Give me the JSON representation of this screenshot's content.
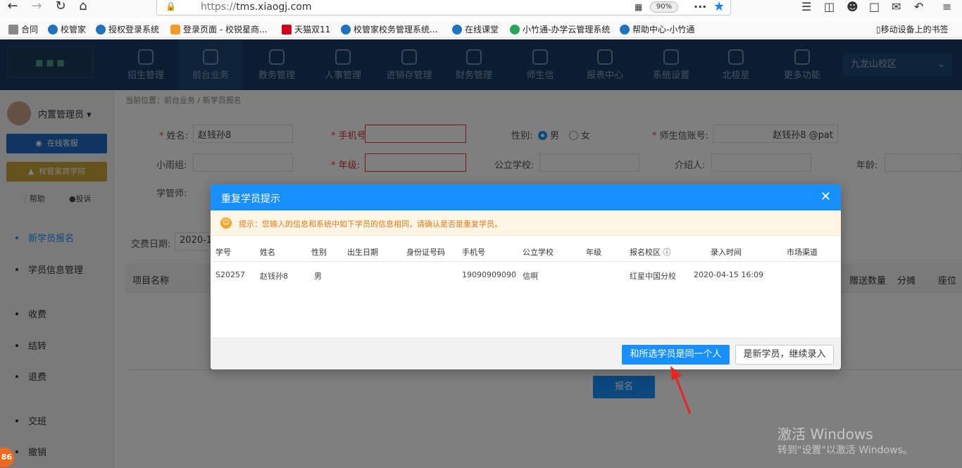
{
  "browser": {
    "url_prefix": "https://",
    "url_host": "tms.xiaogj.com",
    "zoom": "90%",
    "bookmarks": [
      {
        "label": "合同",
        "color": "#888888"
      },
      {
        "label": "校管家",
        "color": "#1e73be"
      },
      {
        "label": "授权登录系统",
        "color": "#1e73be"
      },
      {
        "label": "登录页面 - 校锐星商...",
        "color": "#f59a23"
      },
      {
        "label": "天猫双11",
        "color": "#d0021b"
      },
      {
        "label": "校管家校务管理系统...",
        "color": "#1e73be"
      },
      {
        "label": "在线课堂",
        "color": "#1e73be"
      },
      {
        "label": "小竹通-办学云管理系统",
        "color": "#26a65b"
      },
      {
        "label": "帮助中心-小竹通",
        "color": "#1e73be"
      }
    ],
    "mobile_bookmarks": "移动设备上的书签"
  },
  "app": {
    "nav": [
      {
        "label": "招生管理",
        "active": false
      },
      {
        "label": "前台业务",
        "active": true
      },
      {
        "label": "教务管理",
        "active": false
      },
      {
        "label": "人事管理",
        "active": false
      },
      {
        "label": "进销存管理",
        "active": false
      },
      {
        "label": "财务管理",
        "active": false
      },
      {
        "label": "师生信",
        "active": false
      },
      {
        "label": "报表中心",
        "active": false
      },
      {
        "label": "系统设置",
        "active": false
      },
      {
        "label": "北极星",
        "active": false
      },
      {
        "label": "更多功能",
        "active": false
      }
    ],
    "campus": "九龙山校区"
  },
  "sidebar": {
    "user": "内置管理员",
    "online_service": "在线客服",
    "academy": "校管家商学院",
    "help": "帮助",
    "complaint": "投诉",
    "items": [
      {
        "label": "新学员报名",
        "active": true
      },
      {
        "label": "学员信息管理",
        "active": false
      },
      {
        "label": "收费",
        "active": false
      },
      {
        "label": "结转",
        "active": false
      },
      {
        "label": "退费",
        "active": false
      },
      {
        "label": "交班",
        "active": false
      },
      {
        "label": "撤销",
        "active": false
      }
    ],
    "badge": "86"
  },
  "form": {
    "breadcrumb": "当前位置：前台业务 / 新学员报名",
    "name_label": "姓名:",
    "name_value": "赵钱孙8",
    "phone_label": "手机号:",
    "gender_label": "性别:",
    "gender_male": "男",
    "gender_female": "女",
    "account_label": "师生信账号:",
    "account_value": "赵钱孙8 @pat",
    "group_label": "小雨组:",
    "grade_label": "年级:",
    "school_label": "公立学校:",
    "referrer_label": "介绍人:",
    "age_label": "年龄:",
    "manager_label": "学管师:",
    "pay_date_label": "交费日期:",
    "pay_date_value": "2020-16",
    "col_item": "项目名称",
    "col_gift": "赠送数量",
    "col_share": "分摊",
    "col_seat": "座位",
    "submit": "报名"
  },
  "modal": {
    "title": "重复学员提示",
    "alert": "提示：您输入的信息和系统中如下学员的信息相同，请确认是否是重复学员。",
    "columns": [
      "学号",
      "姓名",
      "性别",
      "出生日期",
      "身份证号码",
      "手机号",
      "公立学校",
      "年级",
      "报名校区",
      "录入时间",
      "市场渠道"
    ],
    "row": {
      "id": "S20257",
      "name": "赵钱孙8",
      "gender": "男",
      "birth": "",
      "idcard": "",
      "phone": "19090909090",
      "school": "信啊",
      "grade": "",
      "campus": "红星中国分校",
      "time": "2020-04-15 16:09",
      "channel": ""
    },
    "btn_same": "和所选学员是同一个人",
    "btn_new": "是新学员，继续录入"
  },
  "watermark": {
    "line1": "激活 Windows",
    "line2": "转到\"设置\"以激活 Windows。"
  }
}
